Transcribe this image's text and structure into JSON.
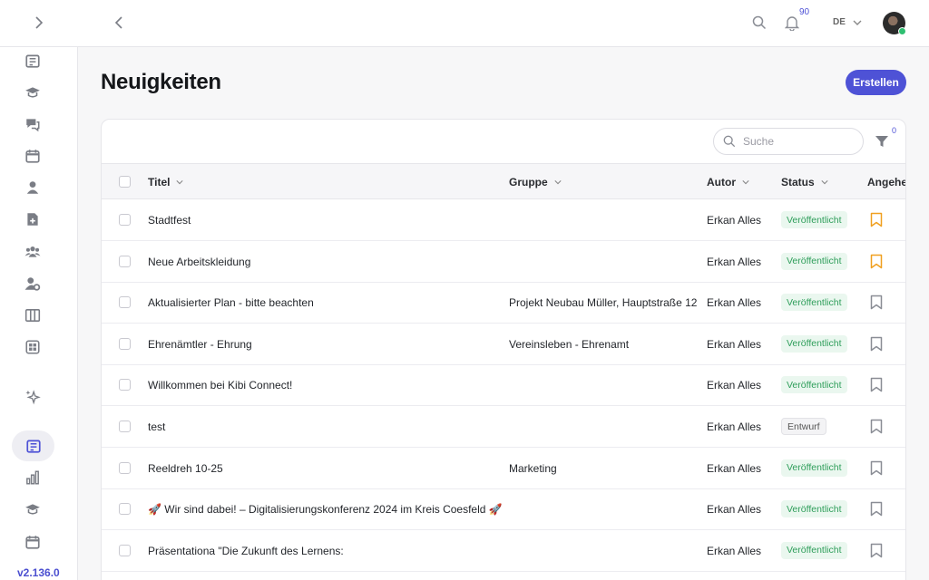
{
  "header": {
    "notification_count": "90",
    "language": "DE"
  },
  "sidebar": {
    "version": "v2.136.0",
    "items": [
      {
        "icon": "news-icon"
      },
      {
        "icon": "graduation-cap-icon"
      },
      {
        "icon": "chat-icon"
      },
      {
        "icon": "calendar-icon"
      },
      {
        "icon": "user-icon"
      },
      {
        "icon": "add-document-icon"
      },
      {
        "icon": "group-icon"
      },
      {
        "icon": "user-settings-icon"
      },
      {
        "icon": "columns-icon"
      },
      {
        "icon": "apps-icon"
      },
      {
        "icon": "sparkles-icon"
      },
      {
        "icon": "news-icon",
        "active": true
      },
      {
        "icon": "bar-chart-icon"
      },
      {
        "icon": "graduation-cap-icon"
      },
      {
        "icon": "calendar-icon"
      }
    ]
  },
  "page": {
    "title": "Neuigkeiten",
    "create_label": "Erstellen"
  },
  "toolbar": {
    "search_placeholder": "Suche",
    "filter_count": "0"
  },
  "table": {
    "columns": {
      "title": "Titel",
      "group": "Gruppe",
      "author": "Autor",
      "status": "Status",
      "pinned": "Angeheftet"
    },
    "rows": [
      {
        "title": "Stadtfest",
        "group": "",
        "author": "Erkan Alles",
        "status": "Veröffentlicht",
        "pinned": true
      },
      {
        "title": "Neue Arbeitskleidung",
        "group": "",
        "author": "Erkan Alles",
        "status": "Veröffentlicht",
        "pinned": true
      },
      {
        "title": "Aktualisierter Plan - bitte beachten",
        "group": "Projekt Neubau Müller, Hauptstraße 12",
        "author": "Erkan Alles",
        "status": "Veröffentlicht",
        "pinned": false
      },
      {
        "title": "Ehrenämtler - Ehrung",
        "group": "Vereinsleben - Ehrenamt",
        "author": "Erkan Alles",
        "status": "Veröffentlicht",
        "pinned": false
      },
      {
        "title": "Willkommen bei Kibi Connect!",
        "group": "",
        "author": "Erkan Alles",
        "status": "Veröffentlicht",
        "pinned": false
      },
      {
        "title": "test",
        "group": "",
        "author": "Erkan Alles",
        "status": "Entwurf",
        "pinned": false
      },
      {
        "title": "Reeldreh 10-25",
        "group": "Marketing",
        "author": "Erkan Alles",
        "status": "Veröffentlicht",
        "pinned": false
      },
      {
        "title": "🚀 Wir sind dabei! – Digitalisierungskonferenz 2024 im Kreis Coesfeld 🚀",
        "group": "",
        "author": "Erkan Alles",
        "status": "Veröffentlicht",
        "pinned": false
      },
      {
        "title": "Präsentationa \"Die Zukunft des Lernens:",
        "group": "",
        "author": "Erkan Alles",
        "status": "Veröffentlicht",
        "pinned": false
      }
    ]
  },
  "colors": {
    "accent": "#4e52d6",
    "pinned": "#f0a020",
    "published_bg": "#eaf7ef",
    "published_text": "#2e9e5a"
  }
}
